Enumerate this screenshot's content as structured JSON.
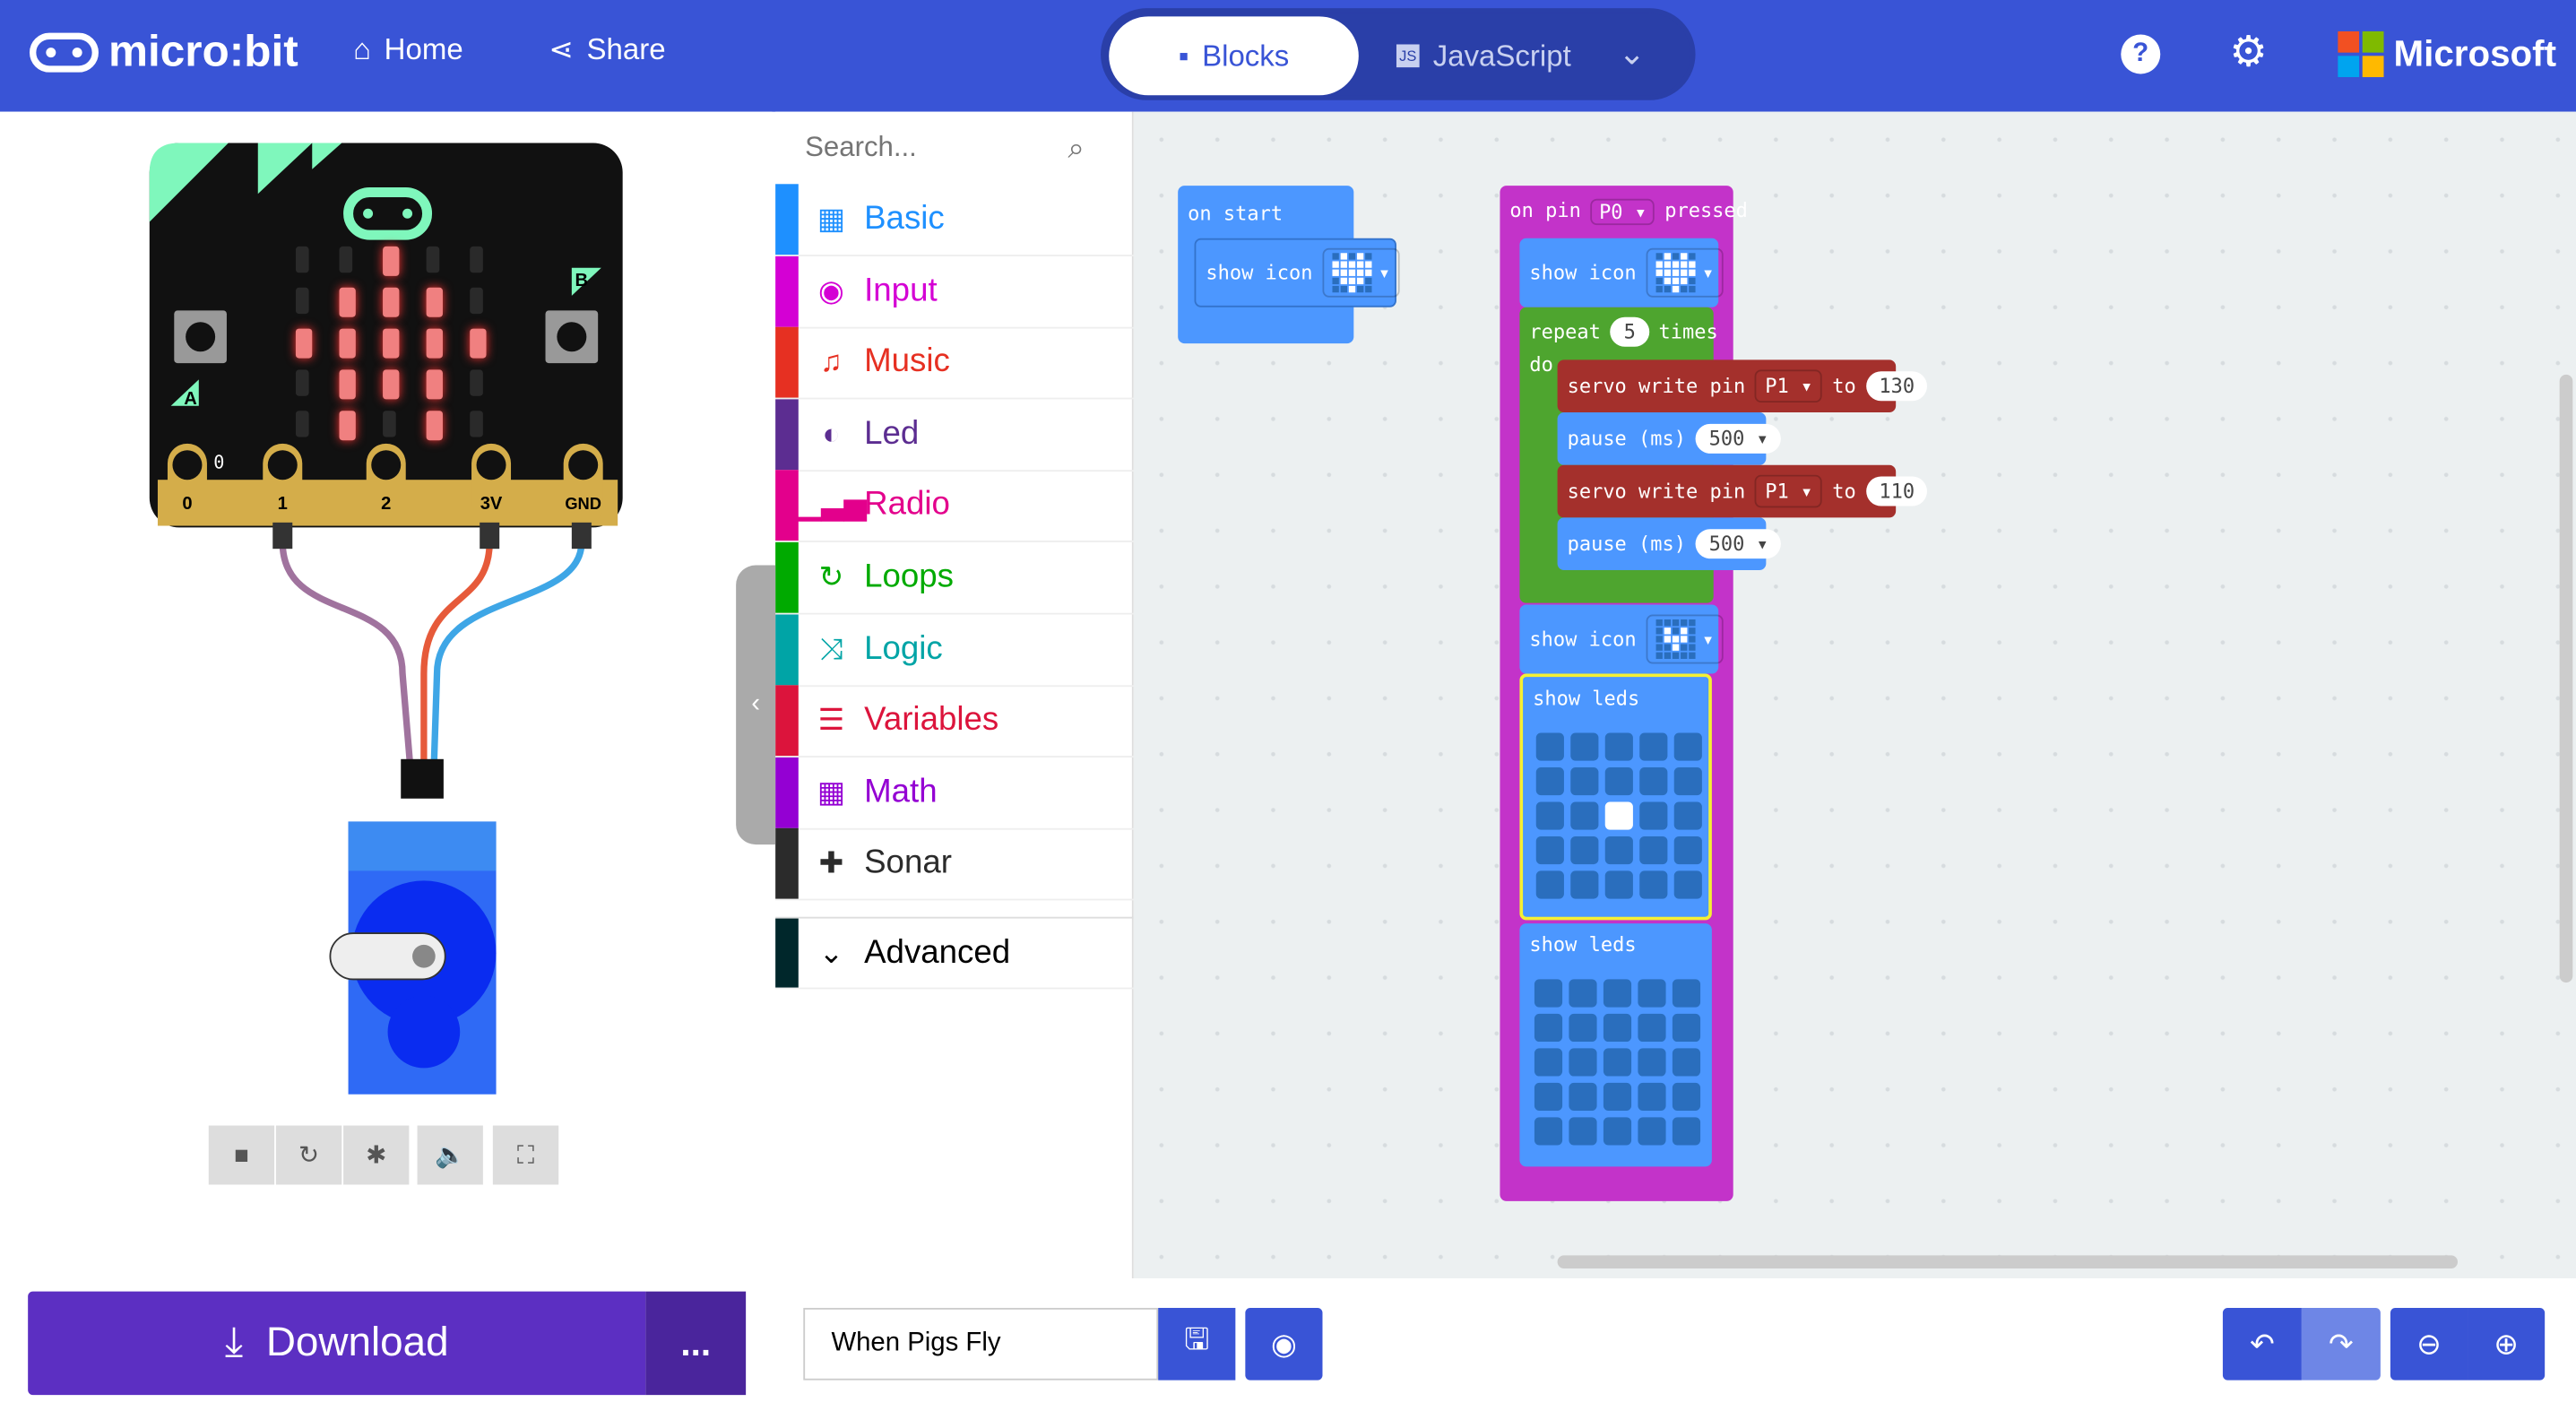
{
  "header": {
    "brand": "micro:bit",
    "home": "Home",
    "share": "Share",
    "tab_blocks": "Blocks",
    "tab_javascript": "JavaScript",
    "microsoft": "Microsoft",
    "color": "#3954d6"
  },
  "simulator": {
    "pins": [
      "0",
      "1",
      "2",
      "3V",
      "GND"
    ],
    "button_a": "A",
    "button_b": "B",
    "pin_zero_label": "0",
    "display": [
      [
        0,
        0,
        1,
        0,
        0
      ],
      [
        0,
        1,
        1,
        1,
        0
      ],
      [
        1,
        1,
        1,
        1,
        1
      ],
      [
        0,
        1,
        1,
        1,
        0
      ],
      [
        0,
        1,
        0,
        1,
        0
      ]
    ],
    "controls": [
      "stop-icon",
      "restart-icon",
      "debug-icon",
      "mute-icon",
      "fullscreen-icon"
    ]
  },
  "toolbox": {
    "search_placeholder": "Search...",
    "categories": [
      {
        "label": "Basic",
        "color": "#1e90ff",
        "icon": "grid-icon"
      },
      {
        "label": "Input",
        "color": "#d400d4",
        "icon": "target-icon"
      },
      {
        "label": "Music",
        "color": "#e63022",
        "icon": "headphones-icon"
      },
      {
        "label": "Led",
        "color": "#5c2d91",
        "icon": "toggle-icon"
      },
      {
        "label": "Radio",
        "color": "#e3008c",
        "icon": "signal-icon"
      },
      {
        "label": "Loops",
        "color": "#00aa00",
        "icon": "refresh-icon"
      },
      {
        "label": "Logic",
        "color": "#00a4a6",
        "icon": "shuffle-icon"
      },
      {
        "label": "Variables",
        "color": "#dc143c",
        "icon": "list-icon"
      },
      {
        "label": "Math",
        "color": "#9400d3",
        "icon": "calculator-icon"
      },
      {
        "label": "Sonar",
        "color": "#2b2b2b",
        "icon": "puzzle-icon"
      }
    ],
    "advanced": "Advanced"
  },
  "blocks": {
    "on_start": "on start",
    "show_icon": "show icon",
    "on_pin": "on pin",
    "pin_p0": "P0",
    "pressed": "pressed",
    "repeat": "repeat",
    "repeat_count": "5",
    "times": "times",
    "do": "do",
    "servo_write_pin": "servo write pin",
    "pin_p1": "P1",
    "to": "to",
    "servo_value_1": "130",
    "servo_value_2": "110",
    "pause_ms": "pause (ms)",
    "pause_value": "500",
    "show_leds": "show leds",
    "heart_icon": [
      [
        0,
        1,
        0,
        1,
        0
      ],
      [
        1,
        1,
        1,
        1,
        1
      ],
      [
        1,
        1,
        1,
        1,
        1
      ],
      [
        0,
        1,
        1,
        1,
        0
      ],
      [
        0,
        0,
        1,
        0,
        0
      ]
    ],
    "small_heart_icon": [
      [
        0,
        0,
        0,
        0,
        0
      ],
      [
        0,
        1,
        0,
        1,
        0
      ],
      [
        0,
        1,
        1,
        1,
        0
      ],
      [
        0,
        0,
        1,
        0,
        0
      ],
      [
        0,
        0,
        0,
        0,
        0
      ]
    ],
    "leds_1": [
      [
        0,
        0,
        0,
        0,
        0
      ],
      [
        0,
        0,
        0,
        0,
        0
      ],
      [
        0,
        0,
        1,
        0,
        0
      ],
      [
        0,
        0,
        0,
        0,
        0
      ],
      [
        0,
        0,
        0,
        0,
        0
      ]
    ],
    "leds_2": [
      [
        0,
        0,
        0,
        0,
        0
      ],
      [
        0,
        0,
        0,
        0,
        0
      ],
      [
        0,
        0,
        0,
        0,
        0
      ],
      [
        0,
        0,
        0,
        0,
        0
      ],
      [
        0,
        0,
        0,
        0,
        0
      ]
    ]
  },
  "footer": {
    "download": "Download",
    "more": "...",
    "project_name": "When Pigs Fly",
    "download_color": "#5c2fc2"
  }
}
